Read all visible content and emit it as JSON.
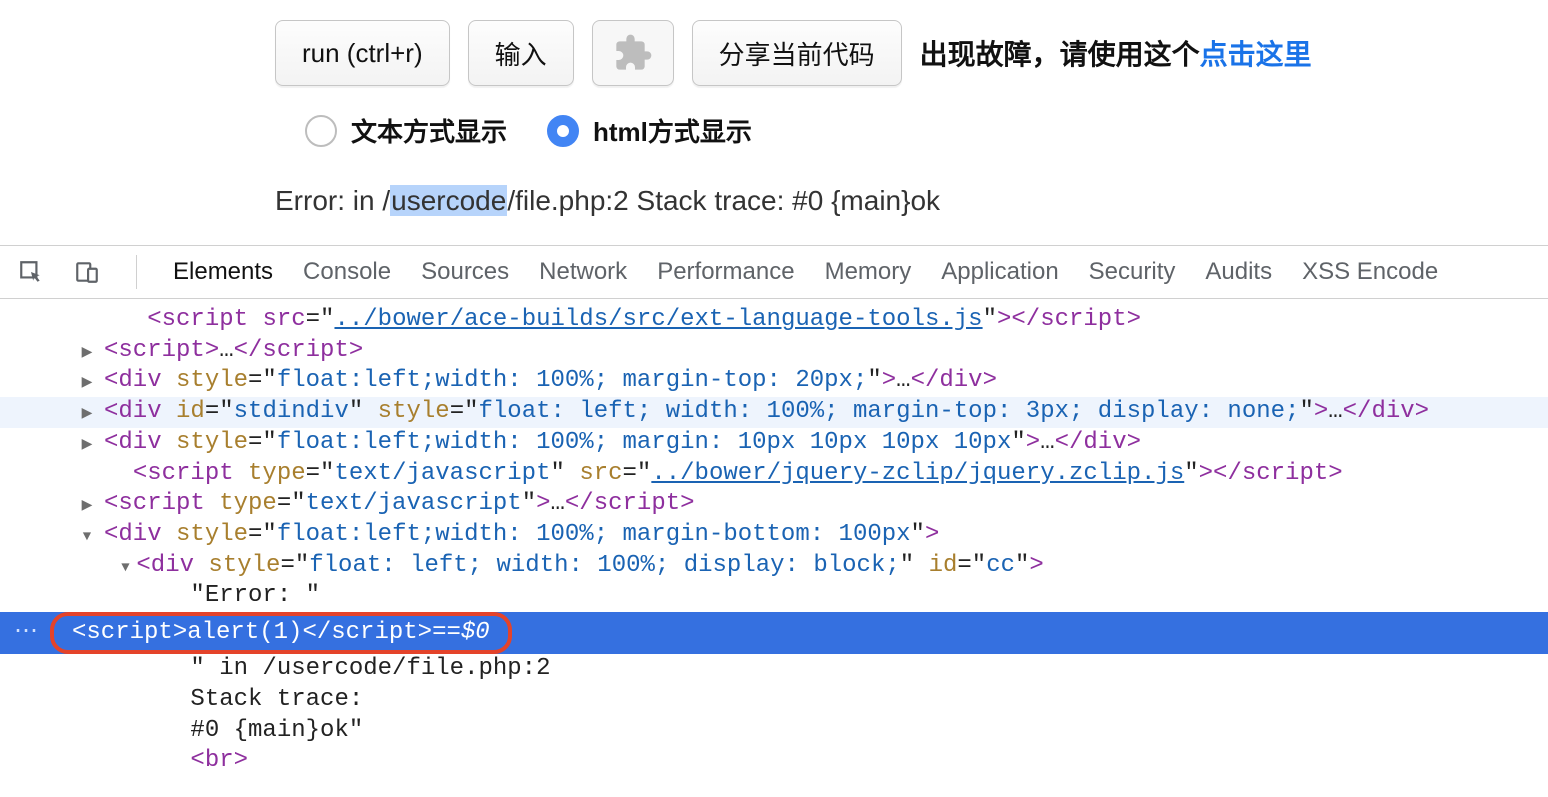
{
  "toolbar": {
    "run": "run (ctrl+r)",
    "input": "输入",
    "share": "分享当前代码",
    "faultPrefix": "出现故障，请使用这个",
    "faultLink": "点击这里"
  },
  "radios": {
    "text": "文本方式显示",
    "html": "html方式显示"
  },
  "errorLine": {
    "prefix": "Error: in /",
    "highlight": "usercode",
    "suffix": "/file.php:2 Stack trace: #0 {main}ok"
  },
  "devtoolsTabs": [
    "Elements",
    "Console",
    "Sources",
    "Network",
    "Performance",
    "Memory",
    "Application",
    "Security",
    "Audits",
    "XSS Encode"
  ],
  "dom": {
    "truncatedLink": "../bower/ace-builds/src/ext-language-tools.js",
    "row1": {
      "open": "<script>",
      "mid": "…",
      "close": "</script>"
    },
    "row2": {
      "tag": "div",
      "style": "float:left;width: 100%; margin-top: 20px;",
      "mid": "…"
    },
    "row3": {
      "tag": "div",
      "id": "stdindiv",
      "style": "float: left; width: 100%; margin-top: 3px; display: none;",
      "mid": "…"
    },
    "row4": {
      "tag": "div",
      "style": "float:left;width: 100%; margin: 10px 10px 10px 10px",
      "mid": "…"
    },
    "row5": {
      "tag": "script",
      "type": "text/javascript",
      "src": "../bower/jquery-zclip/jquery.zclip.js"
    },
    "row6": {
      "tag": "script",
      "type": "text/javascript",
      "mid": "…"
    },
    "row7": {
      "tag": "div",
      "style": "float:left;width: 100%; margin-bottom: 100px"
    },
    "row8": {
      "tag": "div",
      "style": "float: left; width: 100%; display: block;",
      "id": "cc"
    },
    "text1": "\"Error: \"",
    "selected": {
      "open": "<script>",
      "body": "alert(1)",
      "close": "</script>",
      "eq": " == ",
      "ref": "$0"
    },
    "text2": "\" in /usercode/file.php:2",
    "text3": "Stack trace:",
    "text4": "#0 {main}ok\"",
    "br": "<br>"
  }
}
